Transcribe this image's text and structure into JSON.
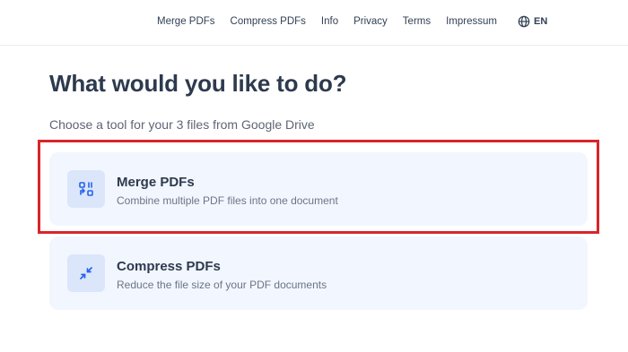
{
  "nav": {
    "links": [
      "Merge PDFs",
      "Compress PDFs",
      "Info",
      "Privacy",
      "Terms",
      "Impressum"
    ],
    "language": "EN"
  },
  "main": {
    "heading": "What would you like to do?",
    "subheading": "Choose a tool for your 3 files from Google Drive"
  },
  "tools": [
    {
      "title": "Merge PDFs",
      "description": "Combine multiple PDF files into one document",
      "icon": "merge-icon",
      "highlighted": true
    },
    {
      "title": "Compress PDFs",
      "description": "Reduce the file size of your PDF documents",
      "icon": "compress-icon"
    }
  ],
  "colors": {
    "accent": "#2563eb",
    "highlight": "#d9242b",
    "card_bg": "#f2f6fe"
  }
}
